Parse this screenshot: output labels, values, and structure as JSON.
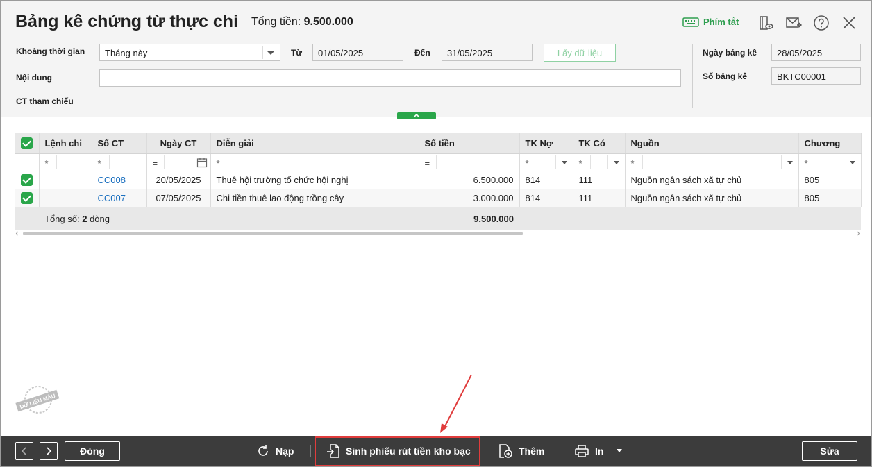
{
  "header": {
    "title": "Bảng kê chứng từ thực chi",
    "total_label": "Tổng tiền:",
    "total_value": "9.500.000",
    "hotkeys_label": "Phím tắt"
  },
  "filters": {
    "period_label": "Khoảng thời gian",
    "period_value": "Tháng này",
    "from_label": "Từ",
    "from_value": "01/05/2025",
    "to_label": "Đến",
    "to_value": "31/05/2025",
    "fetch_label": "Lấy dữ liệu",
    "content_label": "Nội dung",
    "content_value": "",
    "ref_label": "CT tham chiếu",
    "list_date_label": "Ngày bảng kê",
    "list_date_value": "28/05/2025",
    "list_no_label": "Số bảng kê",
    "list_no_value": "BKTC00001"
  },
  "grid": {
    "columns": [
      "Lệnh chi",
      "Số CT",
      "Ngày CT",
      "Diễn giải",
      "Số tiền",
      "TK Nợ",
      "TK Có",
      "Nguồn",
      "Chương"
    ],
    "filter_ops": [
      "*",
      "*",
      "=",
      "*",
      "=",
      "*",
      "*",
      "*",
      "*"
    ],
    "rows": [
      {
        "order": "",
        "doc_no": "CC008",
        "date": "20/05/2025",
        "desc": "Thuê hội trường tổ chức hội nghị",
        "amount": "6.500.000",
        "debit": "814",
        "credit": "111",
        "source": "Nguồn ngân sách xã tự chủ",
        "chapter": "805"
      },
      {
        "order": "",
        "doc_no": "CC007",
        "date": "07/05/2025",
        "desc": "Chi tiền thuê lao động trồng cây",
        "amount": "3.000.000",
        "debit": "814",
        "credit": "111",
        "source": "Nguồn ngân sách xã tự chủ",
        "chapter": "805"
      }
    ],
    "footer_label": "Tổng số:",
    "footer_count": "2",
    "footer_unit": "dòng",
    "footer_total": "9.500.000"
  },
  "stamp_text": "DỮ LIỆU MẪU",
  "footer": {
    "close_label": "Đóng",
    "reload_label": "Nạp",
    "generate_label": "Sinh phiếu rút tiền kho bạc",
    "add_label": "Thêm",
    "print_label": "In",
    "edit_label": "Sửa"
  },
  "colors": {
    "accent": "#2aa64a",
    "link": "#1a6fbf",
    "footer_bg": "#3c3c3c",
    "annotation": "#e03c3c"
  }
}
